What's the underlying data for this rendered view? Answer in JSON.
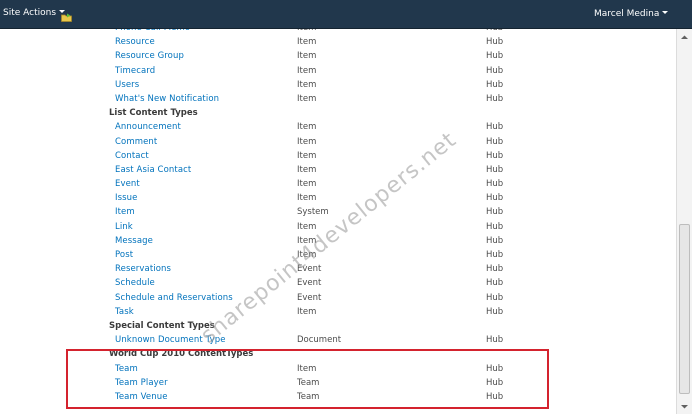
{
  "ribbon": {
    "site_actions_label": "Site Actions",
    "user_name": "Marcel Medina"
  },
  "watermark": "sharepoint4developers.net",
  "rows": [
    {
      "kind": "item",
      "name": "Phone Call Memo",
      "parent": "Item",
      "source": "Hub"
    },
    {
      "kind": "item",
      "name": "Resource",
      "parent": "Item",
      "source": "Hub"
    },
    {
      "kind": "item",
      "name": "Resource Group",
      "parent": "Item",
      "source": "Hub"
    },
    {
      "kind": "item",
      "name": "Timecard",
      "parent": "Item",
      "source": "Hub"
    },
    {
      "kind": "item",
      "name": "Users",
      "parent": "Item",
      "source": "Hub"
    },
    {
      "kind": "item",
      "name": "What's New Notification",
      "parent": "Item",
      "source": "Hub"
    },
    {
      "kind": "group",
      "title": "List Content Types"
    },
    {
      "kind": "item",
      "name": "Announcement",
      "parent": "Item",
      "source": "Hub"
    },
    {
      "kind": "item",
      "name": "Comment",
      "parent": "Item",
      "source": "Hub"
    },
    {
      "kind": "item",
      "name": "Contact",
      "parent": "Item",
      "source": "Hub"
    },
    {
      "kind": "item",
      "name": "East Asia Contact",
      "parent": "Item",
      "source": "Hub"
    },
    {
      "kind": "item",
      "name": "Event",
      "parent": "Item",
      "source": "Hub"
    },
    {
      "kind": "item",
      "name": "Issue",
      "parent": "Item",
      "source": "Hub"
    },
    {
      "kind": "item",
      "name": "Item",
      "parent": "System",
      "source": "Hub"
    },
    {
      "kind": "item",
      "name": "Link",
      "parent": "Item",
      "source": "Hub"
    },
    {
      "kind": "item",
      "name": "Message",
      "parent": "Item",
      "source": "Hub"
    },
    {
      "kind": "item",
      "name": "Post",
      "parent": "Item",
      "source": "Hub"
    },
    {
      "kind": "item",
      "name": "Reservations",
      "parent": "Event",
      "source": "Hub"
    },
    {
      "kind": "item",
      "name": "Schedule",
      "parent": "Event",
      "source": "Hub"
    },
    {
      "kind": "item",
      "name": "Schedule and Reservations",
      "parent": "Event",
      "source": "Hub"
    },
    {
      "kind": "item",
      "name": "Task",
      "parent": "Item",
      "source": "Hub"
    },
    {
      "kind": "group",
      "title": "Special Content Types"
    },
    {
      "kind": "item",
      "name": "Unknown Document Type",
      "parent": "Document",
      "source": "Hub"
    },
    {
      "kind": "group",
      "title": "World Cup 2010 ContentTypes"
    },
    {
      "kind": "item",
      "name": "Team",
      "parent": "Item",
      "source": "Hub"
    },
    {
      "kind": "item",
      "name": "Team Player",
      "parent": "Team",
      "source": "Hub"
    },
    {
      "kind": "item",
      "name": "Team Venue",
      "parent": "Team",
      "source": "Hub"
    }
  ],
  "colors": {
    "ribbon_bg": "#21374c",
    "link": "#0072bc",
    "highlight_border": "#d4232e"
  },
  "icons": {
    "site_actions_caret": "chevron-down-icon",
    "browse": "folder-arrow-icon",
    "user_caret": "chevron-down-icon"
  }
}
